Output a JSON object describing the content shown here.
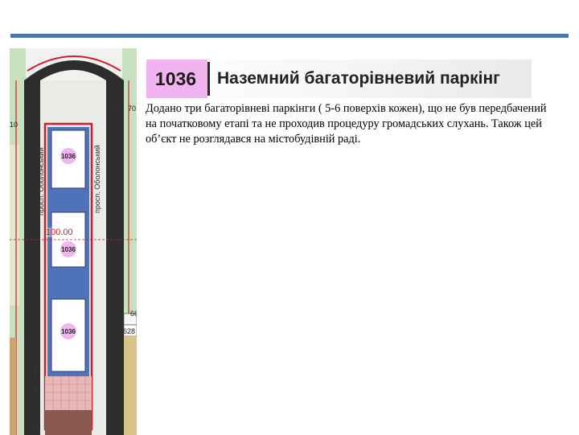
{
  "map": {
    "street_left": "просп. Оболонський",
    "street_right": "просп. Оболонський",
    "street_bottom": "просп. Оболонський",
    "lot_labels": [
      "1036",
      "1036",
      "1036"
    ],
    "elevation": "100.00",
    "edge_numbers": [
      "10",
      "70",
      "66",
      "628"
    ],
    "colors": {
      "lot_fill": "#4f72b8",
      "boundary": "#d21e2a",
      "road": "#2d2d2d",
      "marker": "#f1b6ef"
    }
  },
  "header": {
    "code": "1036",
    "title": "Наземний багаторівневий паркінг",
    "badge_color": "#f3b3f0"
  },
  "description": "Додано три багаторівневі паркінги ( 5-6 поверхів кожен), що не був передбачений  на початковому етапі та не проходив процедуру громадських слухань. Також цей об’єкт не розглядався на містобудівній раді."
}
